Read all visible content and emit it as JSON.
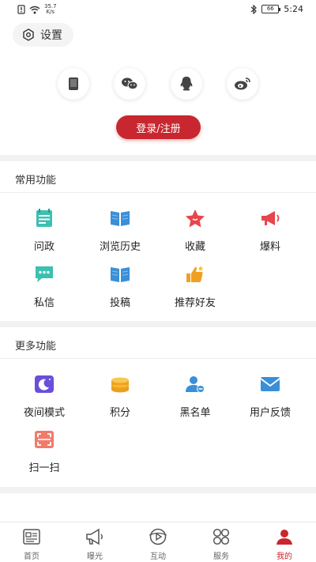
{
  "status_bar": {
    "speed_value": "35.7",
    "speed_unit": "K/s",
    "battery": "66",
    "time": "5:24"
  },
  "header": {
    "settings_label": "设置"
  },
  "social_login": [
    "phone-icon",
    "wechat-icon",
    "qq-icon",
    "weibo-icon"
  ],
  "login_button": "登录/注册",
  "common_functions": {
    "title": "常用功能",
    "items": [
      {
        "label": "问政",
        "icon": "ask-government-icon"
      },
      {
        "label": "浏览历史",
        "icon": "book-icon"
      },
      {
        "label": "收藏",
        "icon": "star-icon"
      },
      {
        "label": "爆料",
        "icon": "megaphone-icon"
      },
      {
        "label": "私信",
        "icon": "chat-bubble-icon"
      },
      {
        "label": "投稿",
        "icon": "book-icon"
      },
      {
        "label": "推荐好友",
        "icon": "thumbs-up-icon"
      }
    ]
  },
  "more_functions": {
    "title": "更多功能",
    "items": [
      {
        "label": "夜间模式",
        "icon": "moon-icon"
      },
      {
        "label": "积分",
        "icon": "coins-icon"
      },
      {
        "label": "黑名单",
        "icon": "user-minus-icon"
      },
      {
        "label": "用户反馈",
        "icon": "mail-icon"
      },
      {
        "label": "扫一扫",
        "icon": "scan-icon"
      }
    ]
  },
  "bottom_nav": [
    {
      "label": "首页",
      "icon": "news-icon"
    },
    {
      "label": "曝光",
      "icon": "megaphone-icon"
    },
    {
      "label": "互动",
      "icon": "interact-icon"
    },
    {
      "label": "服务",
      "icon": "grid-icon"
    },
    {
      "label": "我的",
      "icon": "user-icon",
      "active": true
    }
  ],
  "colors": {
    "accent": "#c8272f",
    "teal": "#3cc0b0",
    "blue": "#3a8fd8",
    "red": "#e8454c",
    "orange": "#f0a020",
    "purple": "#6a4fd8"
  }
}
